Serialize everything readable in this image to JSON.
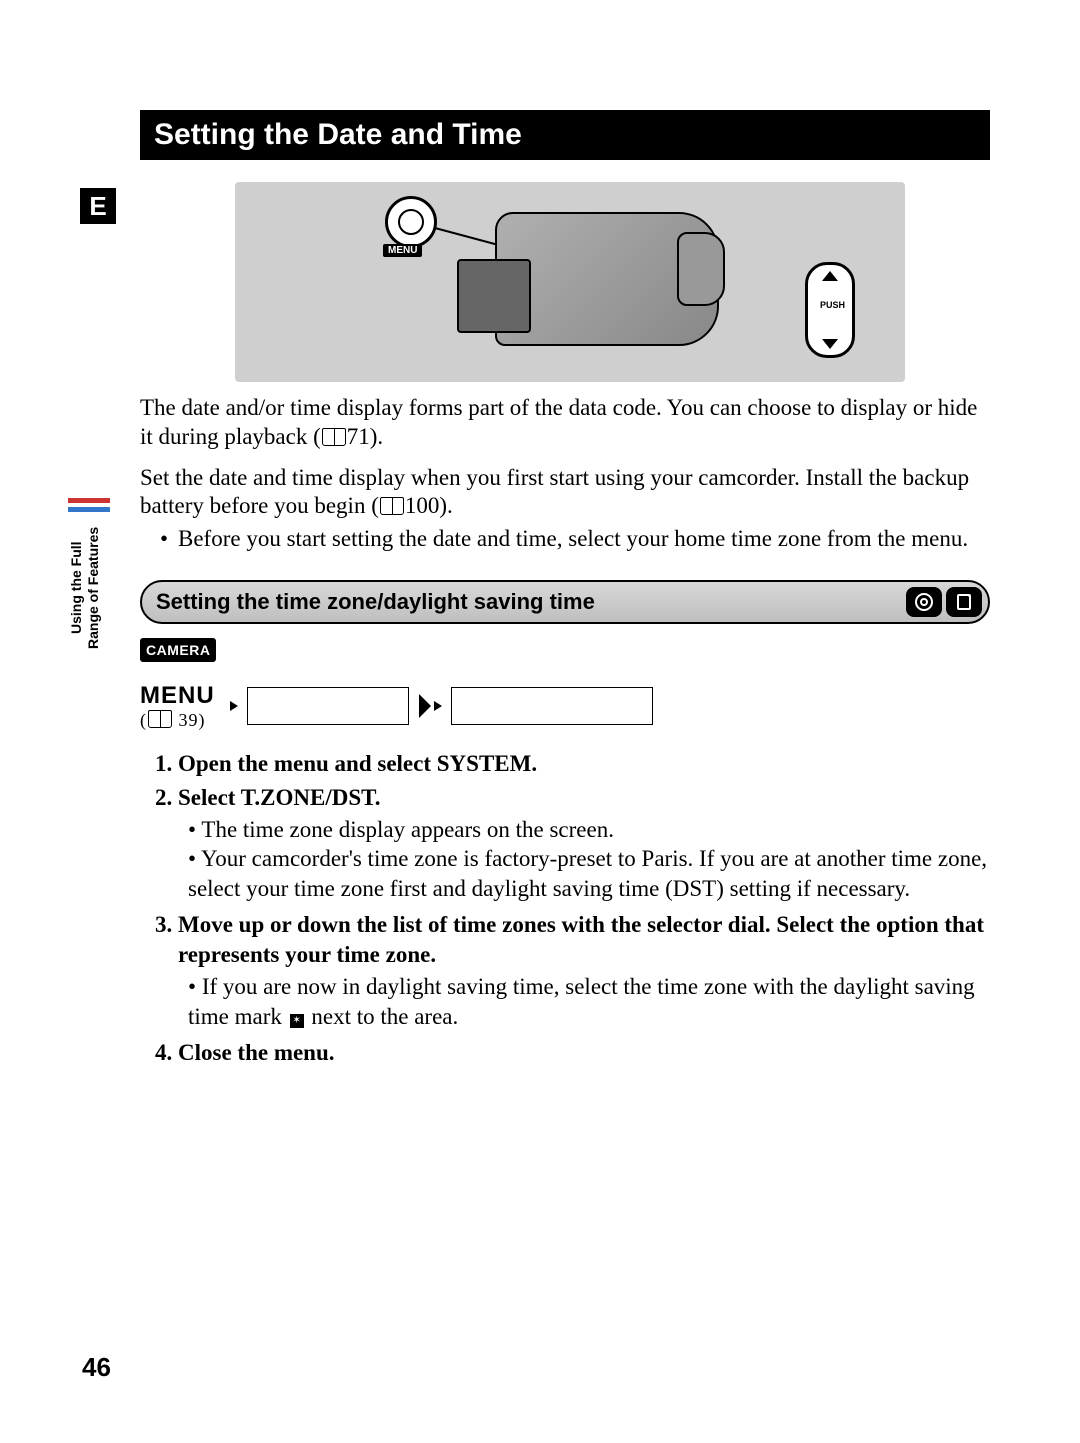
{
  "title": "Setting the Date and Time",
  "lang_badge": "E",
  "illustration": {
    "menu_label": "MENU",
    "push_label": "PUSH"
  },
  "intro": {
    "p1a": "The date and/or time display forms part of the data code. You can choose to display or hide it during playback (",
    "p1_ref": "71",
    "p1b": ").",
    "p2a": "Set the date and time display when you first start using your camcorder. Install the backup battery before you begin (",
    "p2_ref": "100",
    "p2b": ").",
    "bullet": "Before you start setting the date and time, select your home time zone from the menu."
  },
  "side_tab": {
    "line1": "Using the Full",
    "line2": "Range of Features"
  },
  "section_heading": "Setting the time zone/daylight saving time",
  "section_icons": {
    "disc": "disc-icon",
    "card": "card-icon"
  },
  "mode_badge": "CAMERA",
  "menu_row": {
    "label": "MENU",
    "ref": "39"
  },
  "steps": {
    "s1": "Open the menu and select SYSTEM.",
    "s2": "Select T.ZONE/DST.",
    "s2_b1": "The time zone display appears on the screen.",
    "s2_b2": "Your camcorder's time zone is factory-preset to Paris. If you are at another time zone, select your time zone first and daylight saving time (DST) setting if necessary.",
    "s3": "Move up or down the list of time zones with the selector dial. Select the option that represents your time zone.",
    "s3_b1a": "If you are now in daylight saving time, select the time zone with the daylight saving time mark ",
    "s3_b1b": " next to the area.",
    "s4": "Close the menu."
  },
  "page_number": "46"
}
